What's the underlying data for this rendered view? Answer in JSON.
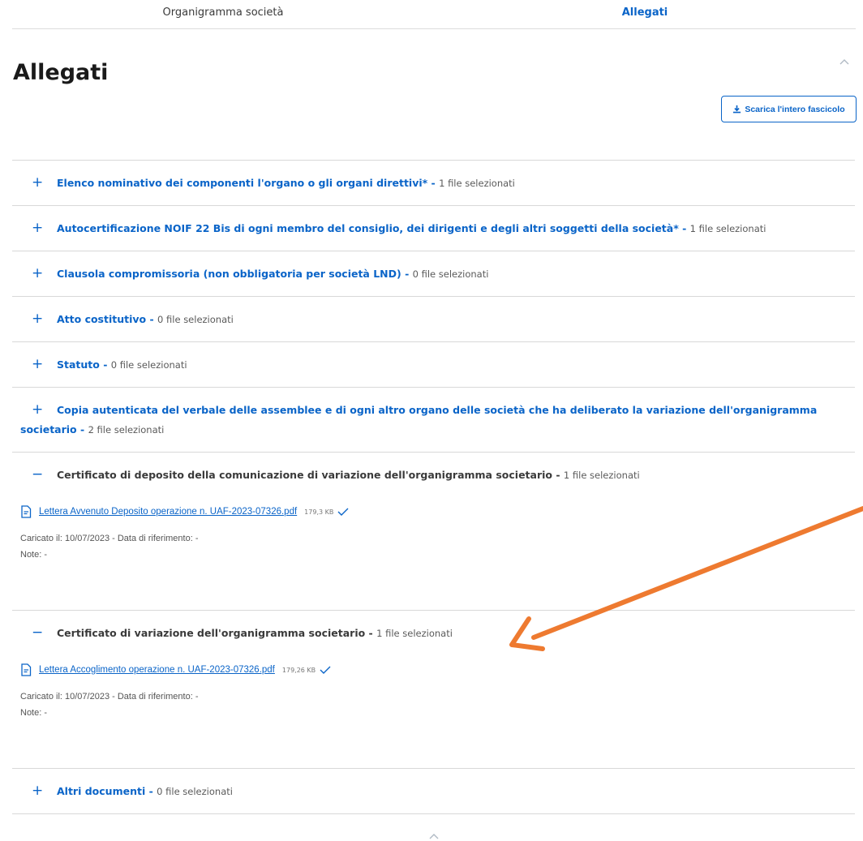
{
  "tabs": [
    {
      "label": "Organigramma società",
      "active": false
    },
    {
      "label": "Allegati",
      "active": true
    }
  ],
  "page_title": "Allegati",
  "download_button": "Scarica l'intero fascicolo",
  "sections": [
    {
      "title": "Elenco nominativo dei componenti l'organo o gli organi direttivi*",
      "count": "1 file selezionati",
      "open": false
    },
    {
      "title": "Autocertificazione NOIF 22 Bis di ogni membro del consiglio, dei dirigenti e degli altri soggetti della società*",
      "count": "1 file selezionati",
      "open": false
    },
    {
      "title": "Clausola compromissoria (non obbligatoria per società LND)",
      "count": "0 file selezionati",
      "open": false
    },
    {
      "title": "Atto costitutivo",
      "count": "0 file selezionati",
      "open": false
    },
    {
      "title": "Statuto",
      "count": "0 file selezionati",
      "open": false
    },
    {
      "title": "Copia autenticata del verbale delle assemblee e di ogni altro organo delle società che ha deliberato la variazione dell'organigramma societario",
      "count": "2 file selezionati",
      "open": false
    },
    {
      "title": "Certificato di deposito della comunicazione di variazione dell'organigramma societario",
      "count": "1 file selezionati",
      "open": true,
      "file": {
        "name": "Lettera Avvenuto Deposito operazione n. UAF-2023-07326.pdf",
        "size": "179,3 KB",
        "uploaded": "Caricato il: 10/07/2023 - Data di riferimento: -",
        "notes": "Note: -"
      }
    },
    {
      "title": "Certificato di variazione dell'organigramma societario",
      "count": "1 file selezionati",
      "open": true,
      "file": {
        "name": "Lettera Accoglimento operazione n. UAF-2023-07326.pdf",
        "size": "179,26 KB",
        "uploaded": "Caricato il: 10/07/2023 - Data di riferimento: -",
        "notes": "Note: -"
      }
    },
    {
      "title": "Altri documenti",
      "count": "0 file selezionati",
      "open": false
    }
  ],
  "symbols": {
    "collapsed": "+",
    "expanded": "−"
  },
  "separator": " - ",
  "colors": {
    "accent": "#0a64c8",
    "annotation": "#ee7a30"
  },
  "icons": {
    "chevron": "chevron-up-icon",
    "file": "file-icon",
    "check": "check-icon",
    "download": "download-icon"
  }
}
